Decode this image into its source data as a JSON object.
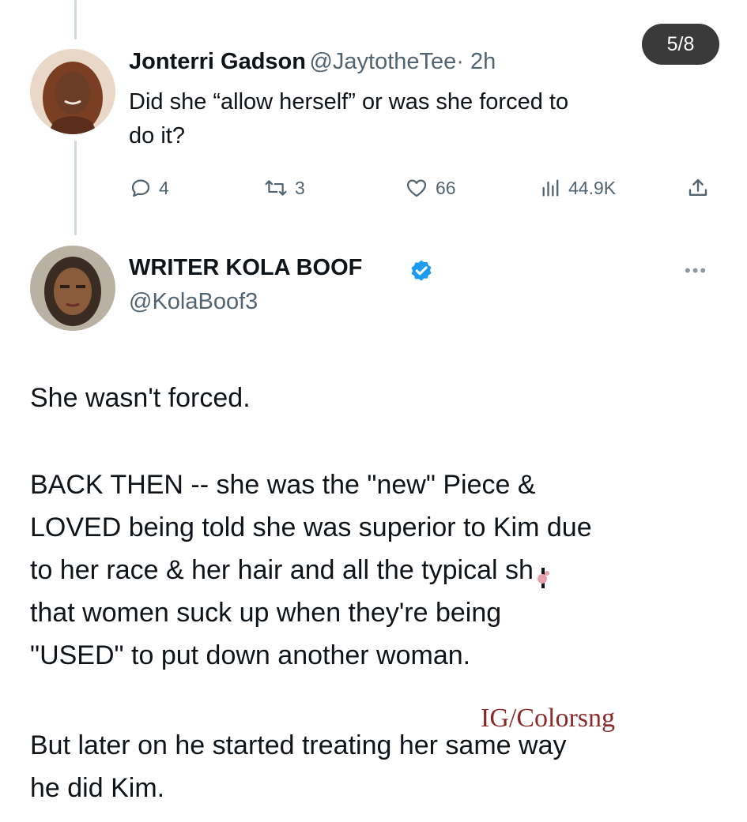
{
  "badge": {
    "page_counter": "5/8"
  },
  "reply": {
    "display_name": "Jonterri Gadson",
    "handle": "@JaytotheTee",
    "time": "· 2h",
    "text_line1": "Did she “allow herself” or was she forced to",
    "text_line2": "do it?",
    "actions": {
      "replies": "4",
      "reposts": "3",
      "likes": "66",
      "views": "44.9K"
    }
  },
  "tweet": {
    "display_name": "WRITER KOLA BOOF",
    "handle": "@KolaBoof3",
    "paragraph1": "She wasn't forced.",
    "paragraph2_lines": [
      "BACK THEN -- she was the \"new\" Piece &",
      "LOVED being told she was superior to Kim due",
      "to her race & her hair and all the typical sh",
      "that women suck up when they're being",
      "\"USED\" to put down another woman."
    ],
    "paragraph3_lines": [
      "But later on he started treating her same way",
      "he did Kim."
    ]
  },
  "watermark": "IG/Colorsng",
  "colors": {
    "verified": "#1d9bf0",
    "muted": "#536471",
    "badge_bg": "#3a3a3a"
  }
}
